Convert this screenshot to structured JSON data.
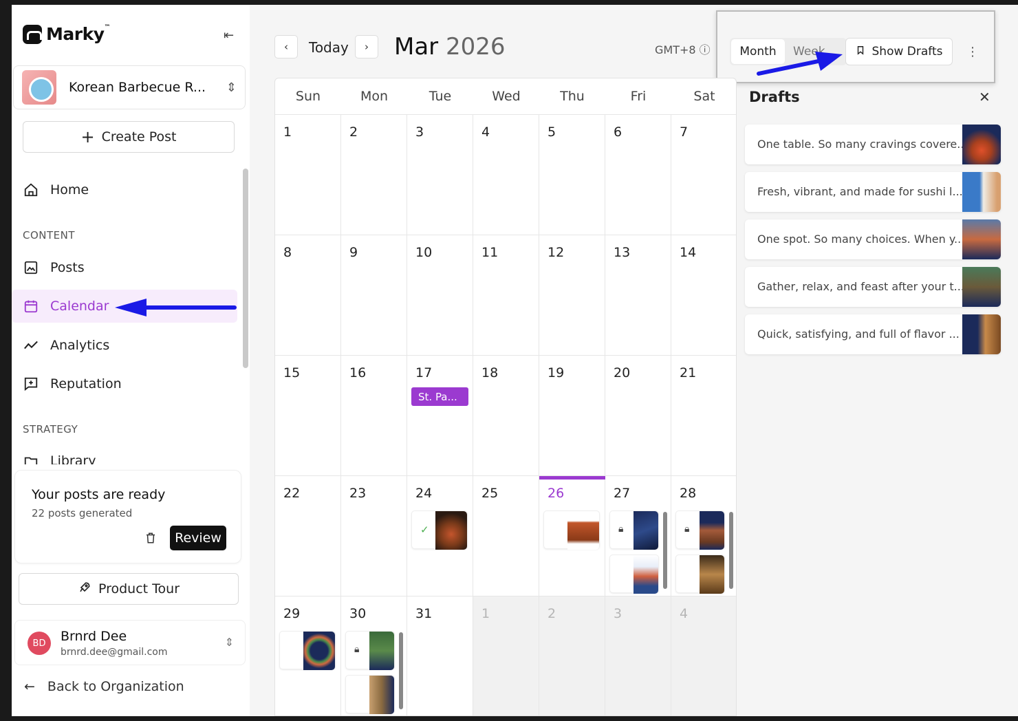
{
  "brand": {
    "name": "Marky",
    "tm": "™"
  },
  "org": {
    "name": "Korean Barbecue R..."
  },
  "sidebar": {
    "create_label": "Create Post",
    "items": [
      {
        "label": "Home",
        "icon": "home-icon"
      },
      {
        "label": "Posts",
        "icon": "image-icon"
      },
      {
        "label": "Calendar",
        "icon": "calendar-icon",
        "active": true
      },
      {
        "label": "Analytics",
        "icon": "trend-icon"
      },
      {
        "label": "Reputation",
        "icon": "message-plus-icon"
      },
      {
        "label": "Library",
        "icon": "folder-icon"
      }
    ],
    "section_content": "CONTENT",
    "section_strategy": "STRATEGY",
    "ready_title": "Your posts are ready",
    "ready_sub": "22 posts generated",
    "review_label": "Review",
    "tour_label": "Product Tour",
    "user": {
      "initials": "BD",
      "name": "Brnrd Dee",
      "email": "brnrd.dee@gmail.com"
    },
    "back_label": "Back to Organization"
  },
  "toolbar": {
    "today": "Today",
    "month": "Mar",
    "year": "2026",
    "timezone": "GMT+8",
    "view_month": "Month",
    "view_week": "Week",
    "show_drafts": "Show Drafts"
  },
  "calendar": {
    "weekdays": [
      "Sun",
      "Mon",
      "Tue",
      "Wed",
      "Thu",
      "Fri",
      "Sat"
    ],
    "weeks": [
      [
        "1",
        "2",
        "3",
        "4",
        "5",
        "6",
        "7"
      ],
      [
        "8",
        "9",
        "10",
        "11",
        "12",
        "13",
        "14"
      ],
      [
        "15",
        "16",
        "17",
        "18",
        "19",
        "20",
        "21"
      ],
      [
        "22",
        "23",
        "24",
        "25",
        "26",
        "27",
        "28"
      ],
      [
        "29",
        "30",
        "31",
        "1",
        "2",
        "3",
        "4"
      ]
    ],
    "event_label": "St. Pa...",
    "today_date": "26"
  },
  "drafts": {
    "title": "Drafts",
    "items": [
      "One table. So many cravings covere...",
      "Fresh, vibrant, and made for sushi l...",
      "One spot. So many choices. When y...",
      "Gather, relax, and feast after your t...",
      "Quick, satisfying, and full of flavor ..."
    ]
  },
  "colors": {
    "accent": "#9b3ad0",
    "annotation": "#1a1ae6"
  }
}
